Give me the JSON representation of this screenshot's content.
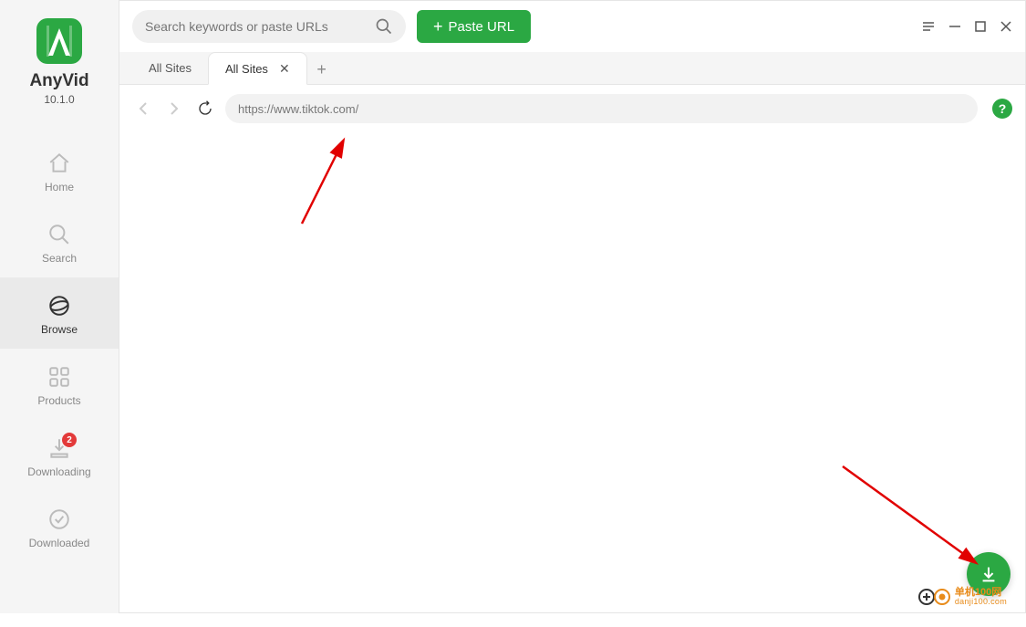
{
  "app": {
    "name": "AnyVid",
    "version": "10.1.0"
  },
  "sidebar": {
    "items": [
      {
        "label": "Home"
      },
      {
        "label": "Search"
      },
      {
        "label": "Browse"
      },
      {
        "label": "Products"
      },
      {
        "label": "Downloading",
        "badge": "2"
      },
      {
        "label": "Downloaded"
      }
    ]
  },
  "topbar": {
    "search_placeholder": "Search keywords or paste URLs",
    "paste_btn": "Paste URL"
  },
  "tabs": [
    {
      "label": "All Sites",
      "active": false,
      "closable": false
    },
    {
      "label": "All Sites",
      "active": true,
      "closable": true
    }
  ],
  "browser": {
    "url": "https://www.tiktok.com/"
  },
  "watermark": {
    "line1": "单机100网",
    "line2": "danji100.com"
  }
}
